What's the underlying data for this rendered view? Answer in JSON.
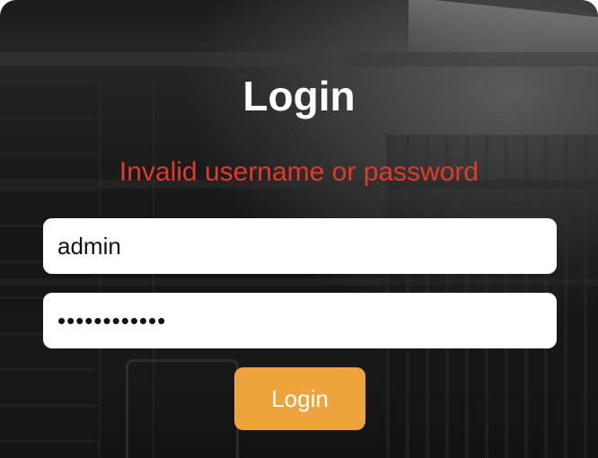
{
  "form": {
    "title": "Login",
    "error_message": "Invalid username or password",
    "username_value": "admin",
    "password_value": "••••••••••••",
    "submit_label": "Login"
  },
  "colors": {
    "error": "#e03a2a",
    "button": "#eea43c",
    "title": "#ffffff"
  }
}
